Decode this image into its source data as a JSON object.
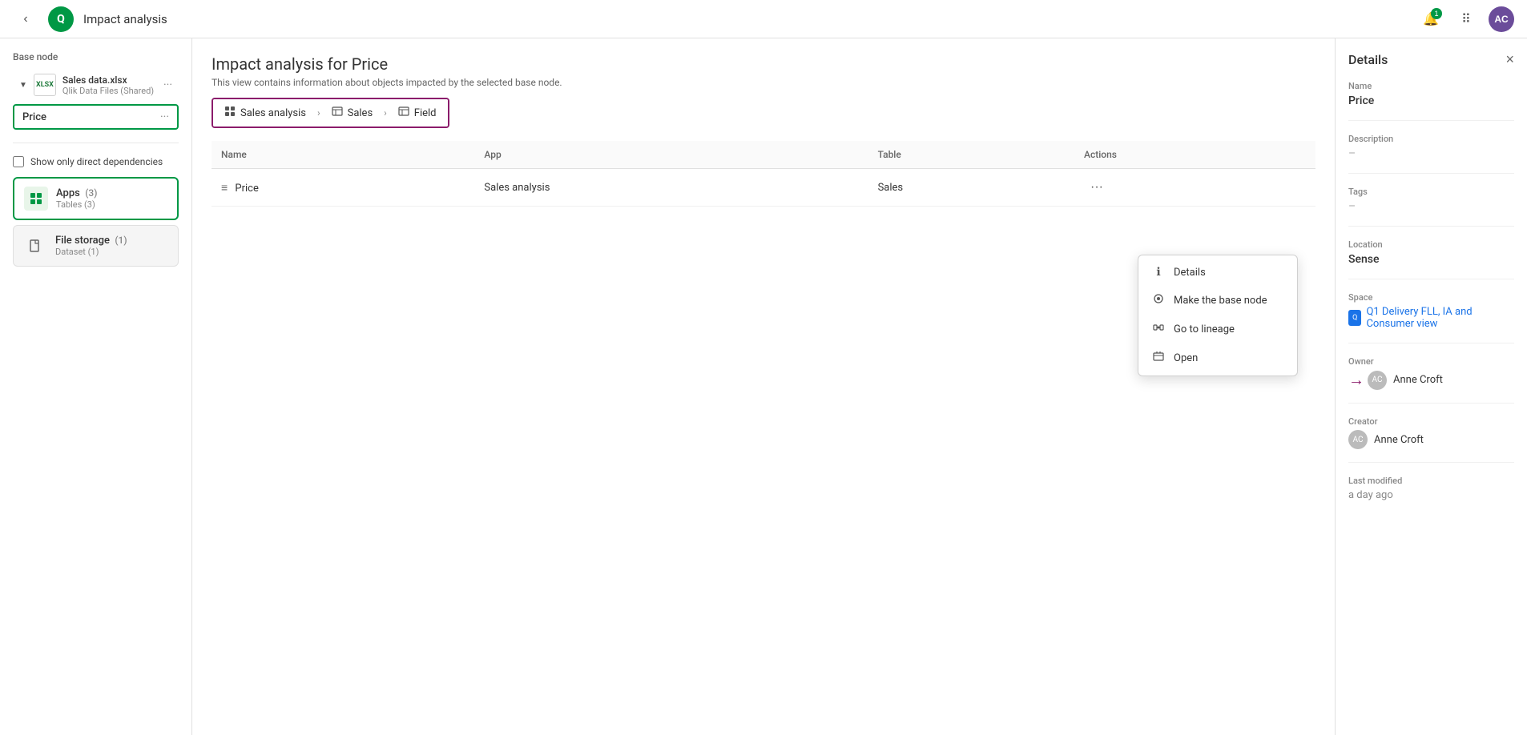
{
  "topbar": {
    "back_icon": "‹",
    "title": "Impact analysis",
    "notification_count": "1",
    "avatar_initials": "AC"
  },
  "left_sidebar": {
    "base_node_label": "Base node",
    "file_name": "Sales data.xlsx",
    "file_source": "Qlik Data Files (Shared)",
    "price_chip_label": "Price",
    "checkbox_label": "Show only direct dependencies",
    "nav_items": [
      {
        "id": "apps",
        "label": "Apps",
        "count": "3",
        "sub": "Tables (3)",
        "active": true
      },
      {
        "id": "file-storage",
        "label": "File storage",
        "count": "1",
        "sub": "Dataset (1)",
        "active": false
      }
    ]
  },
  "breadcrumb": {
    "items": [
      {
        "label": "Sales analysis",
        "icon": "☰"
      },
      {
        "label": "Sales",
        "icon": "⊞"
      },
      {
        "label": "Field",
        "icon": "⊞"
      }
    ]
  },
  "main": {
    "title": "Impact analysis for Price",
    "subtitle": "This view contains information about objects impacted by the selected base node.",
    "table": {
      "columns": [
        "Name",
        "App",
        "Table",
        "Actions"
      ],
      "rows": [
        {
          "name": "Price",
          "name_icon": "≡",
          "app": "Sales analysis",
          "table": "Sales"
        }
      ]
    }
  },
  "context_menu": {
    "items": [
      {
        "id": "details",
        "label": "Details",
        "icon": "ℹ"
      },
      {
        "id": "make-base-node",
        "label": "Make the base node",
        "icon": "⊙"
      },
      {
        "id": "go-to-lineage",
        "label": "Go to lineage",
        "icon": "⊕"
      },
      {
        "id": "open",
        "label": "Open",
        "icon": "⬚"
      }
    ]
  },
  "right_panel": {
    "title": "Details",
    "close_icon": "×",
    "name_label": "Name",
    "name_value": "Price",
    "description_label": "Description",
    "description_value": "–",
    "tags_label": "Tags",
    "tags_value": "–",
    "location_label": "Location",
    "location_value": "Sense",
    "space_label": "Space",
    "space_value": "Q1 Delivery FLL, IA and Consumer view",
    "owner_label": "Owner",
    "owner_value": "Anne Croft",
    "creator_label": "Creator",
    "creator_value": "Anne Croft",
    "last_modified_label": "Last modified",
    "last_modified_value": "a day ago"
  }
}
